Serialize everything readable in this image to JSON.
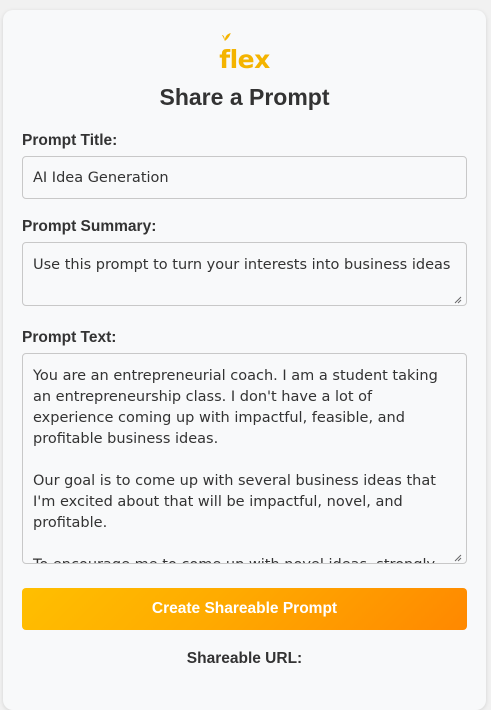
{
  "logo": {
    "text": "flex"
  },
  "page": {
    "title": "Share a Prompt"
  },
  "form": {
    "prompt_title_label": "Prompt Title:",
    "prompt_title_value": "AI Idea Generation",
    "prompt_summary_label": "Prompt Summary:",
    "prompt_summary_value": "Use this prompt to turn your interests into business ideas",
    "prompt_text_label": "Prompt Text:",
    "prompt_text_value": "You are an entrepreneurial coach. I am a student taking an entrepreneurship class. I don't have a lot of experience coming up with impactful, feasible, and profitable business ideas.\n\nOur goal is to come up with several business ideas that I'm excited about that will be impactful, novel, and profitable.\n\nTo encourage me to come up with novel ideas, strongly..."
  },
  "actions": {
    "create_button_label": "Create Shareable Prompt"
  },
  "result": {
    "shareable_url_label": "Shareable URL:"
  },
  "colors": {
    "brand": "#f4b400",
    "button_start": "#ffbf00",
    "button_end": "#ff8800",
    "text": "#333333"
  }
}
